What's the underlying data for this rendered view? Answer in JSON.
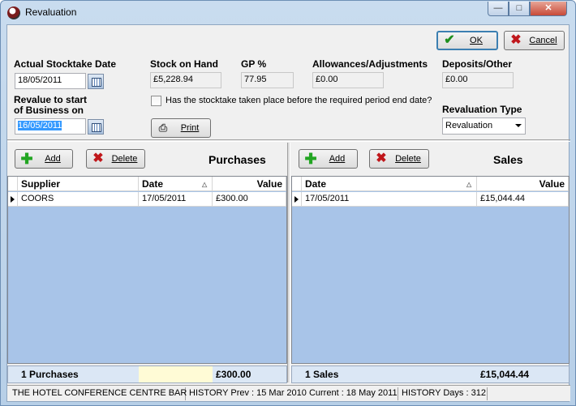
{
  "window": {
    "title": "Revaluation",
    "min_glyph": "—",
    "max_glyph": "□",
    "close_glyph": "✕"
  },
  "toolbar": {
    "ok_label": "OK",
    "cancel_label": "Cancel"
  },
  "form": {
    "stocktake_date_label": "Actual Stocktake Date",
    "stocktake_date_value": "18/05/2011",
    "revalue_label_line1": "Revalue to start",
    "revalue_label_line2": "of Business on",
    "revalue_date_value": "16/05/2011",
    "stock_on_hand_label": "Stock on Hand",
    "stock_on_hand_value": "£5,228.94",
    "gp_label": "GP %",
    "gp_value": "77.95",
    "allowances_label": "Allowances/Adjustments",
    "allowances_value": "£0.00",
    "deposits_label": "Deposits/Other",
    "deposits_value": "£0.00",
    "period_question": "Has the stocktake taken place before the required period end date?",
    "period_checked": false,
    "print_label": "Print",
    "revaluation_type_label": "Revaluation Type",
    "revaluation_type_value": "Revaluation"
  },
  "purchases": {
    "title": "Purchases",
    "add_label": "Add",
    "delete_label": "Delete",
    "columns": [
      "Supplier",
      "Date",
      "Value"
    ],
    "rows": [
      {
        "supplier": "COORS",
        "date": "17/05/2011",
        "value": "£300.00"
      }
    ],
    "totals_count": "1 Purchases",
    "totals_value": "£300.00"
  },
  "sales": {
    "title": "Sales",
    "add_label": "Add",
    "delete_label": "Delete",
    "columns": [
      "Date",
      "Value"
    ],
    "rows": [
      {
        "date": "17/05/2011",
        "value": "£15,044.44"
      }
    ],
    "totals_count": "1 Sales",
    "totals_value": "£15,044.44"
  },
  "status": {
    "location": "THE HOTEL CONFERENCE CENTRE BAR",
    "history": "HISTORY Prev : 15 Mar 2010  Current : 18 May 2011",
    "history_days": "HISTORY Days : 312"
  },
  "icons": {
    "ok": "check-icon",
    "cancel": "x-icon",
    "add": "plus-icon",
    "delete": "delete-x-icon",
    "print": "printer-icon",
    "calendar": "calendar-icon"
  },
  "colors": {
    "grid_bg": "#a8c4e8",
    "selection": "#3399ff",
    "ok_green": "#1e8f1e",
    "delete_red": "#c0171b"
  }
}
